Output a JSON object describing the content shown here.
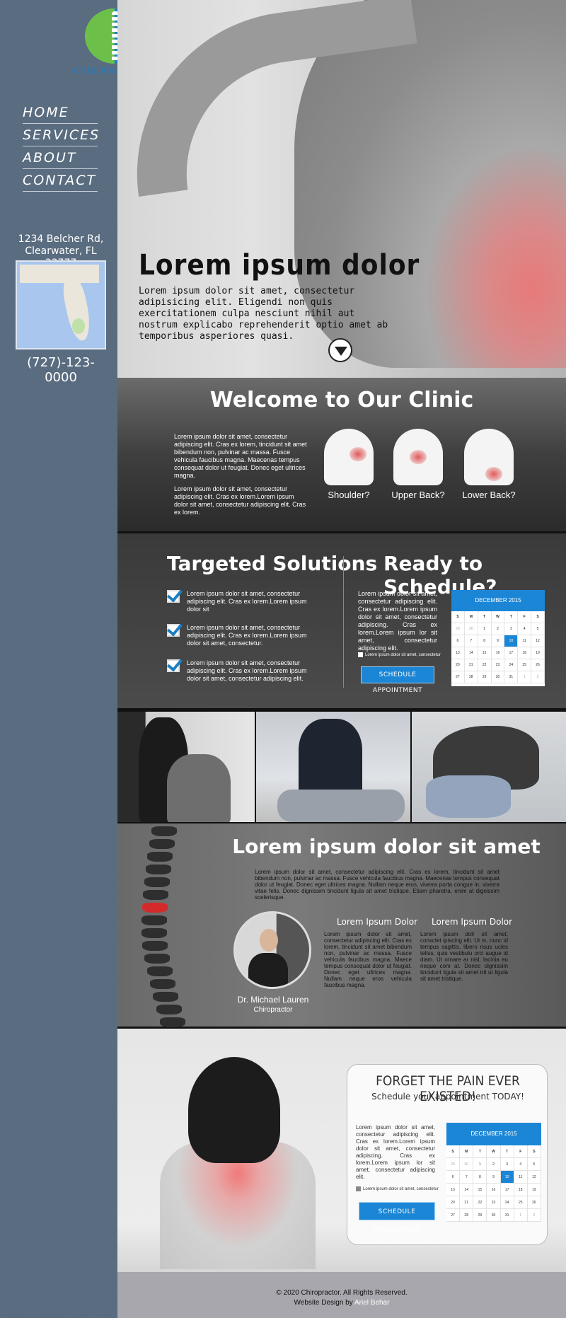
{
  "sidebar": {
    "logo_text": "CHIROPRACTOR",
    "nav": [
      "HOME",
      "SERVICES",
      "ABOUT",
      "CONTACT"
    ],
    "address_line1": "1234 Belcher Rd,",
    "address_line2": "Clearwater, FL 33777",
    "phone": "(727)-123-0000"
  },
  "hero": {
    "title": "Lorem ipsum dolor",
    "text": "Lorem ipsum dolor sit amet, consectetur adipisicing elit. Eligendi non quis exercitationem culpa nesciunt nihil aut nostrum explicabo reprehenderit optio amet ab temporibus asperiores quasi."
  },
  "welcome": {
    "title": "Welcome to Our Clinic",
    "paragraph1": "Lorem ipsum dolor sit amet, consectetur adipiscing elit. Cras ex lorem, tincidunt sit amet bibendum non, pulvinar ac massa. Fusce vehicula faucibus magna. Maecenas tempus consequat dolor ut feugiat. Donec eget ultrices magna.",
    "paragraph2": "Lorem ipsum dolor sit amet, consectetur adipiscing elit. Cras ex lorem.Lorem ipsum dolor sit amet, consectetur adipiscing elit. Cras ex lorem.",
    "pain_points": [
      "Shoulder?",
      "Upper Back?",
      "Lower Back?"
    ]
  },
  "solutions": {
    "title": "Targeted Solutions",
    "items": [
      "Lorem ipsum dolor sit amet, consectetur adipiscing elit. Cras ex lorem.Lorem ipsum dolor sit",
      "Lorem ipsum dolor sit amet, consectetur adipiscing elit. Cras ex lorem.Lorem ipsum dolor sit amet, consectetur.",
      "Lorem ipsum dolor sit amet, consectetur adipiscing elit. Cras ex lorem.Lorem ipsum dolor sit amet, consectetur adipiscing elit."
    ]
  },
  "schedule": {
    "title": "Ready to Schedule?",
    "text": "Lorem ipsum dolor sit amet, consectetur adipiscing elit. Cras ex lorem.Lorem ipsum dolor sit amet, consectetur adipiscing. Cras ex lorem.Lorem ipsum lor sit amet, consectetur adipiscing elit.",
    "checkbox_label": "Lorem ipsum dolor sit amet, consectetur",
    "button": "SCHEDULE APPOINTMENT"
  },
  "calendar": {
    "month": "DECEMBER 2015",
    "days_of_week": [
      "S",
      "M",
      "T",
      "W",
      "T",
      "F",
      "S"
    ],
    "dates": [
      "29",
      "30",
      "1",
      "2",
      "3",
      "4",
      "5",
      "6",
      "7",
      "8",
      "9",
      "10",
      "11",
      "12",
      "13",
      "14",
      "15",
      "16",
      "17",
      "18",
      "19",
      "20",
      "21",
      "22",
      "23",
      "24",
      "25",
      "26",
      "27",
      "28",
      "29",
      "30",
      "31",
      "1",
      "2"
    ],
    "dim_indices": [
      0,
      1,
      33,
      34
    ],
    "selected": "10"
  },
  "doctor": {
    "title": "Lorem ipsum dolor sit amet",
    "intro": "Lorem ipsum dolor sit amet, consectetur adipiscing elit. Cras ex lorem, tincidunt sit amet bibendum non, pulvinar ac massa. Fusce vehicula faucibus magna. Maecenas tempus consequat dolor ut feugiat. Donec eget ultrices magna. Nullam neque eros, viverra porta congue in, viverra vitae felis. Donec dignissim tincidunt ligula sit amet tristique. Etiam pharetra, enim at dignissim scelerisque.",
    "name": "Dr. Michael Lauren",
    "role": "Chiropractor",
    "col1_title": "Lorem Ipsum Dolor",
    "col1_text": "Lorem ipsum dolor sit amet, consectetur adipiscing elit. Cras ex lorem, tincidunt sit amet bibendum non, pulvinar ac massa. Fusce vehicula faucibus magna. Maece tempus consequat dolor ut feugiat. Donec eget ultrices magna. Nullam neque eros vehicula faucibus magna.",
    "col2_title": "Lorem Ipsum Dolor",
    "col2_text": "Lorem ipsum dolr sit amet, consctet ipiscing elit. Ut m, nunc id tempus sagittis, libero risus ucies tellus, quis vestibulu orci augue id diam. Ut ornare ar nisl, lacinia eu neque com at. Donec dignissim tincidunt ligula sit amet trti ut ligula sit amet tristique."
  },
  "cta": {
    "title": "FORGET THE PAIN EVER EXISTED!",
    "subtitle": "Schedule your appointment TODAY!",
    "text": "Lorem ipsum dolor sit amet, consectetur adipiscing elit. Cras ex lorem.Lorem ipsum dolor sit amet, consectetur adipiscing. Cras ex lorem.Lorem ipsum lor sit amet, consectetur adipiscing elit.",
    "checkbox_label": "Lorem ipsum dolor sit amet, consectetur",
    "button": "SCHEDULE APPOINTMENT"
  },
  "footer": {
    "copyright": "© 2020 Chiropractor. All Rights Reserved.",
    "credit_prefix": "Website Design by",
    "credit_name": "Ariel Behar"
  },
  "colors": {
    "accent": "#1b86d6",
    "sidebar": "#5a6a7c",
    "logo_green": "#6cc04a"
  }
}
